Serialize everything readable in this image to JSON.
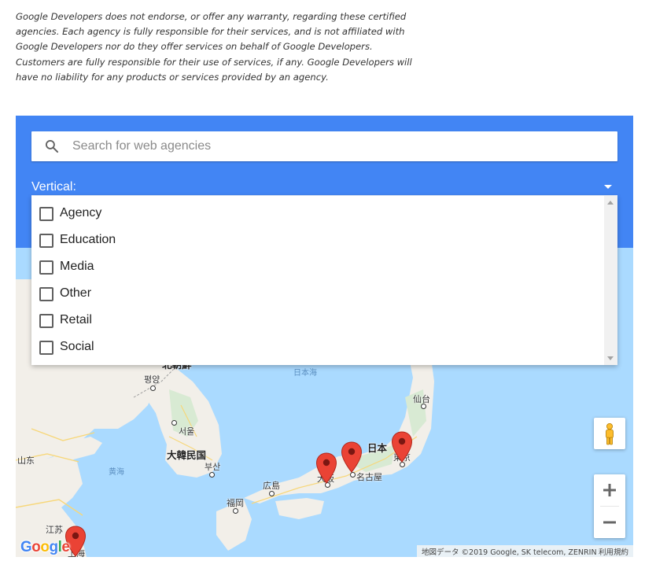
{
  "disclaimer": {
    "line1": "Google Developers does not endorse, or offer any warranty, regarding these certified",
    "line2": "agencies. Each agency is fully responsible for their services, and is not affiliated with",
    "line3": "Google Developers nor do they offer services on behalf of Google Developers.",
    "line4": "Customers are fully responsible for their use of services, if any. Google Developers will",
    "line5": "have no liability for any products or services provided by an agency."
  },
  "search": {
    "placeholder": "Search for web agencies",
    "value": ""
  },
  "filter": {
    "label": "Vertical:",
    "options": [
      {
        "label": "Agency",
        "checked": false
      },
      {
        "label": "Education",
        "checked": false
      },
      {
        "label": "Media",
        "checked": false
      },
      {
        "label": "Other",
        "checked": false
      },
      {
        "label": "Retail",
        "checked": false
      },
      {
        "label": "Social",
        "checked": false
      }
    ]
  },
  "map": {
    "labels": {
      "sea_of_japan": "日本海",
      "north_korea": "北朝鮮",
      "pyongyang": "평양",
      "seoul": "서울",
      "south_korea": "大韓民国",
      "busan": "부산",
      "yellow_sea": "黄海",
      "shandong": "山东",
      "jiangsu": "江苏",
      "shanghai": "上海",
      "fukuoka": "福岡",
      "hiroshima": "広島",
      "osaka": "大阪",
      "nagoya": "名古屋",
      "japan": "日本",
      "tokyo": "東京",
      "sendai": "仙台"
    },
    "logo": "Google",
    "attribution": "地図データ ©2019 Google, SK telecom, ZENRIN",
    "terms": "利用規約",
    "zoom_in": "+",
    "zoom_out": "−"
  },
  "colors": {
    "panel": "#4285f4",
    "water": "#aadaff",
    "land": "#f2efe9",
    "marker": "#ea4335"
  }
}
